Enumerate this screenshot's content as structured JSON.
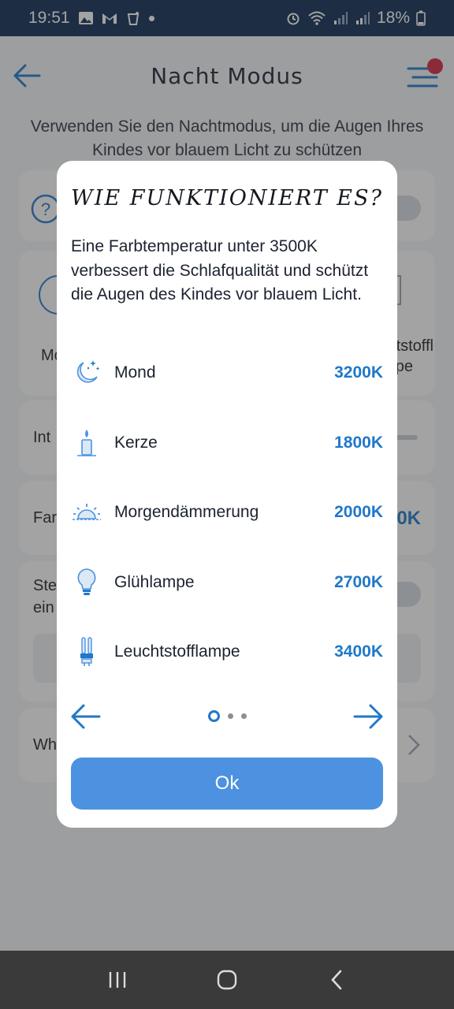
{
  "status_bar": {
    "time": "19:51",
    "battery": "18%"
  },
  "header": {
    "title": "Nacht Modus"
  },
  "subtitle": "Verwenden Sie den Nachtmodus, um die Augen Ihres Kindes vor blauem Licht zu schützen",
  "background": {
    "mo_label": "Mo",
    "stoffl_label": "tstoffl",
    "pe_label": "pe",
    "int_label": "Int",
    "far_label": "Far",
    "far_value": "0K",
    "ste_label": "Ste",
    "ein_label": "ein",
    "wh_label": "Wh"
  },
  "modal": {
    "title": "WIE FUNKTIONIERT ES?",
    "description": "Eine Farbtemperatur unter 3500K verbessert die Schlafqualität und schützt die Augen des Kindes vor blauem Licht.",
    "items": [
      {
        "icon": "moon-icon",
        "name": "Mond",
        "temp": "3200K"
      },
      {
        "icon": "candle-icon",
        "name": "Kerze",
        "temp": "1800K"
      },
      {
        "icon": "sunrise-icon",
        "name": "Morgendämmerung",
        "temp": "2000K"
      },
      {
        "icon": "bulb-icon",
        "name": "Glühlampe",
        "temp": "2700K"
      },
      {
        "icon": "fluorescent-lamp-icon",
        "name": "Leuchtstofflampe",
        "temp": "3400K"
      }
    ],
    "pagination": {
      "current": 1,
      "total": 3
    },
    "ok_label": "Ok"
  },
  "colors": {
    "accent": "#1f78c8",
    "button": "#4d92e0",
    "status_bar": "#0b2a52",
    "notification_dot": "#d3253b"
  }
}
